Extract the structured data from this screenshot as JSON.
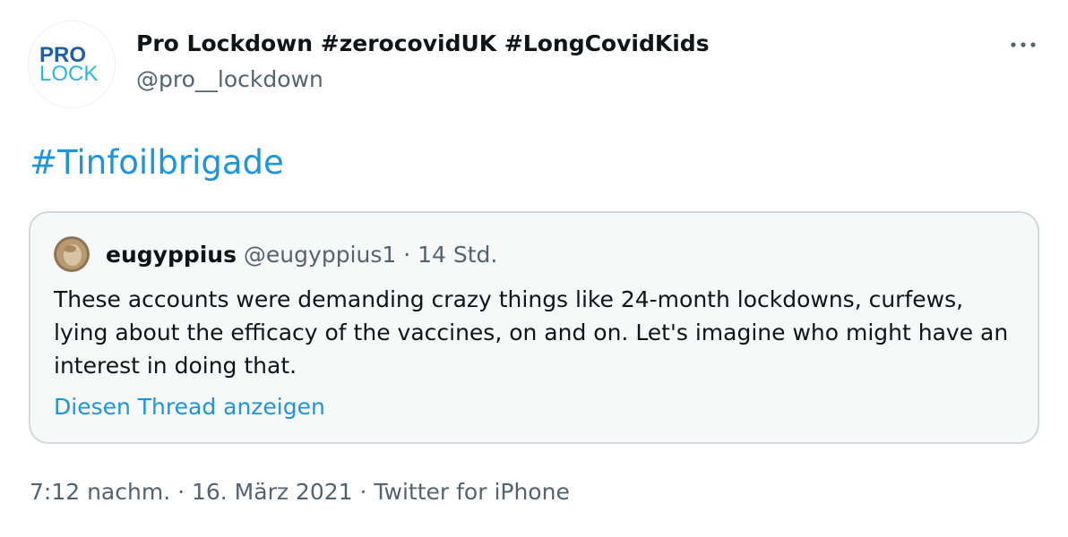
{
  "author": {
    "display_name": "Pro Lockdown #zerocovidUK #LongCovidKids",
    "handle": "@pro__lockdown",
    "avatar_line1": "PRO",
    "avatar_line2": "LOCK"
  },
  "tweet": {
    "text": "#Tinfoilbrigade"
  },
  "quoted_tweet": {
    "display_name": "eugyppius",
    "meta": " @eugyppius1 · 14 Std.",
    "text": "These accounts were demanding crazy things like 24-month lockdowns, curfews, lying about the efficacy of the vaccines, on and on. Let's imagine who might have an interest in doing that.",
    "show_thread_label": "Diesen Thread anzeigen"
  },
  "footer": {
    "meta": "7:12 nachm. · 16. März 2021 · Twitter for iPhone"
  },
  "icons": {
    "more": "more-dots-icon",
    "avatar": "pro-lock-logo",
    "quote_avatar": "user-avatar"
  },
  "colors": {
    "link": "#1b95e0",
    "text": "#0f1419",
    "secondary": "#536471",
    "card_border": "#cfd9de",
    "card_bg": "#f7f9f9",
    "logo_blue": "#1f5fa8",
    "logo_cyan": "#29b6e8"
  }
}
